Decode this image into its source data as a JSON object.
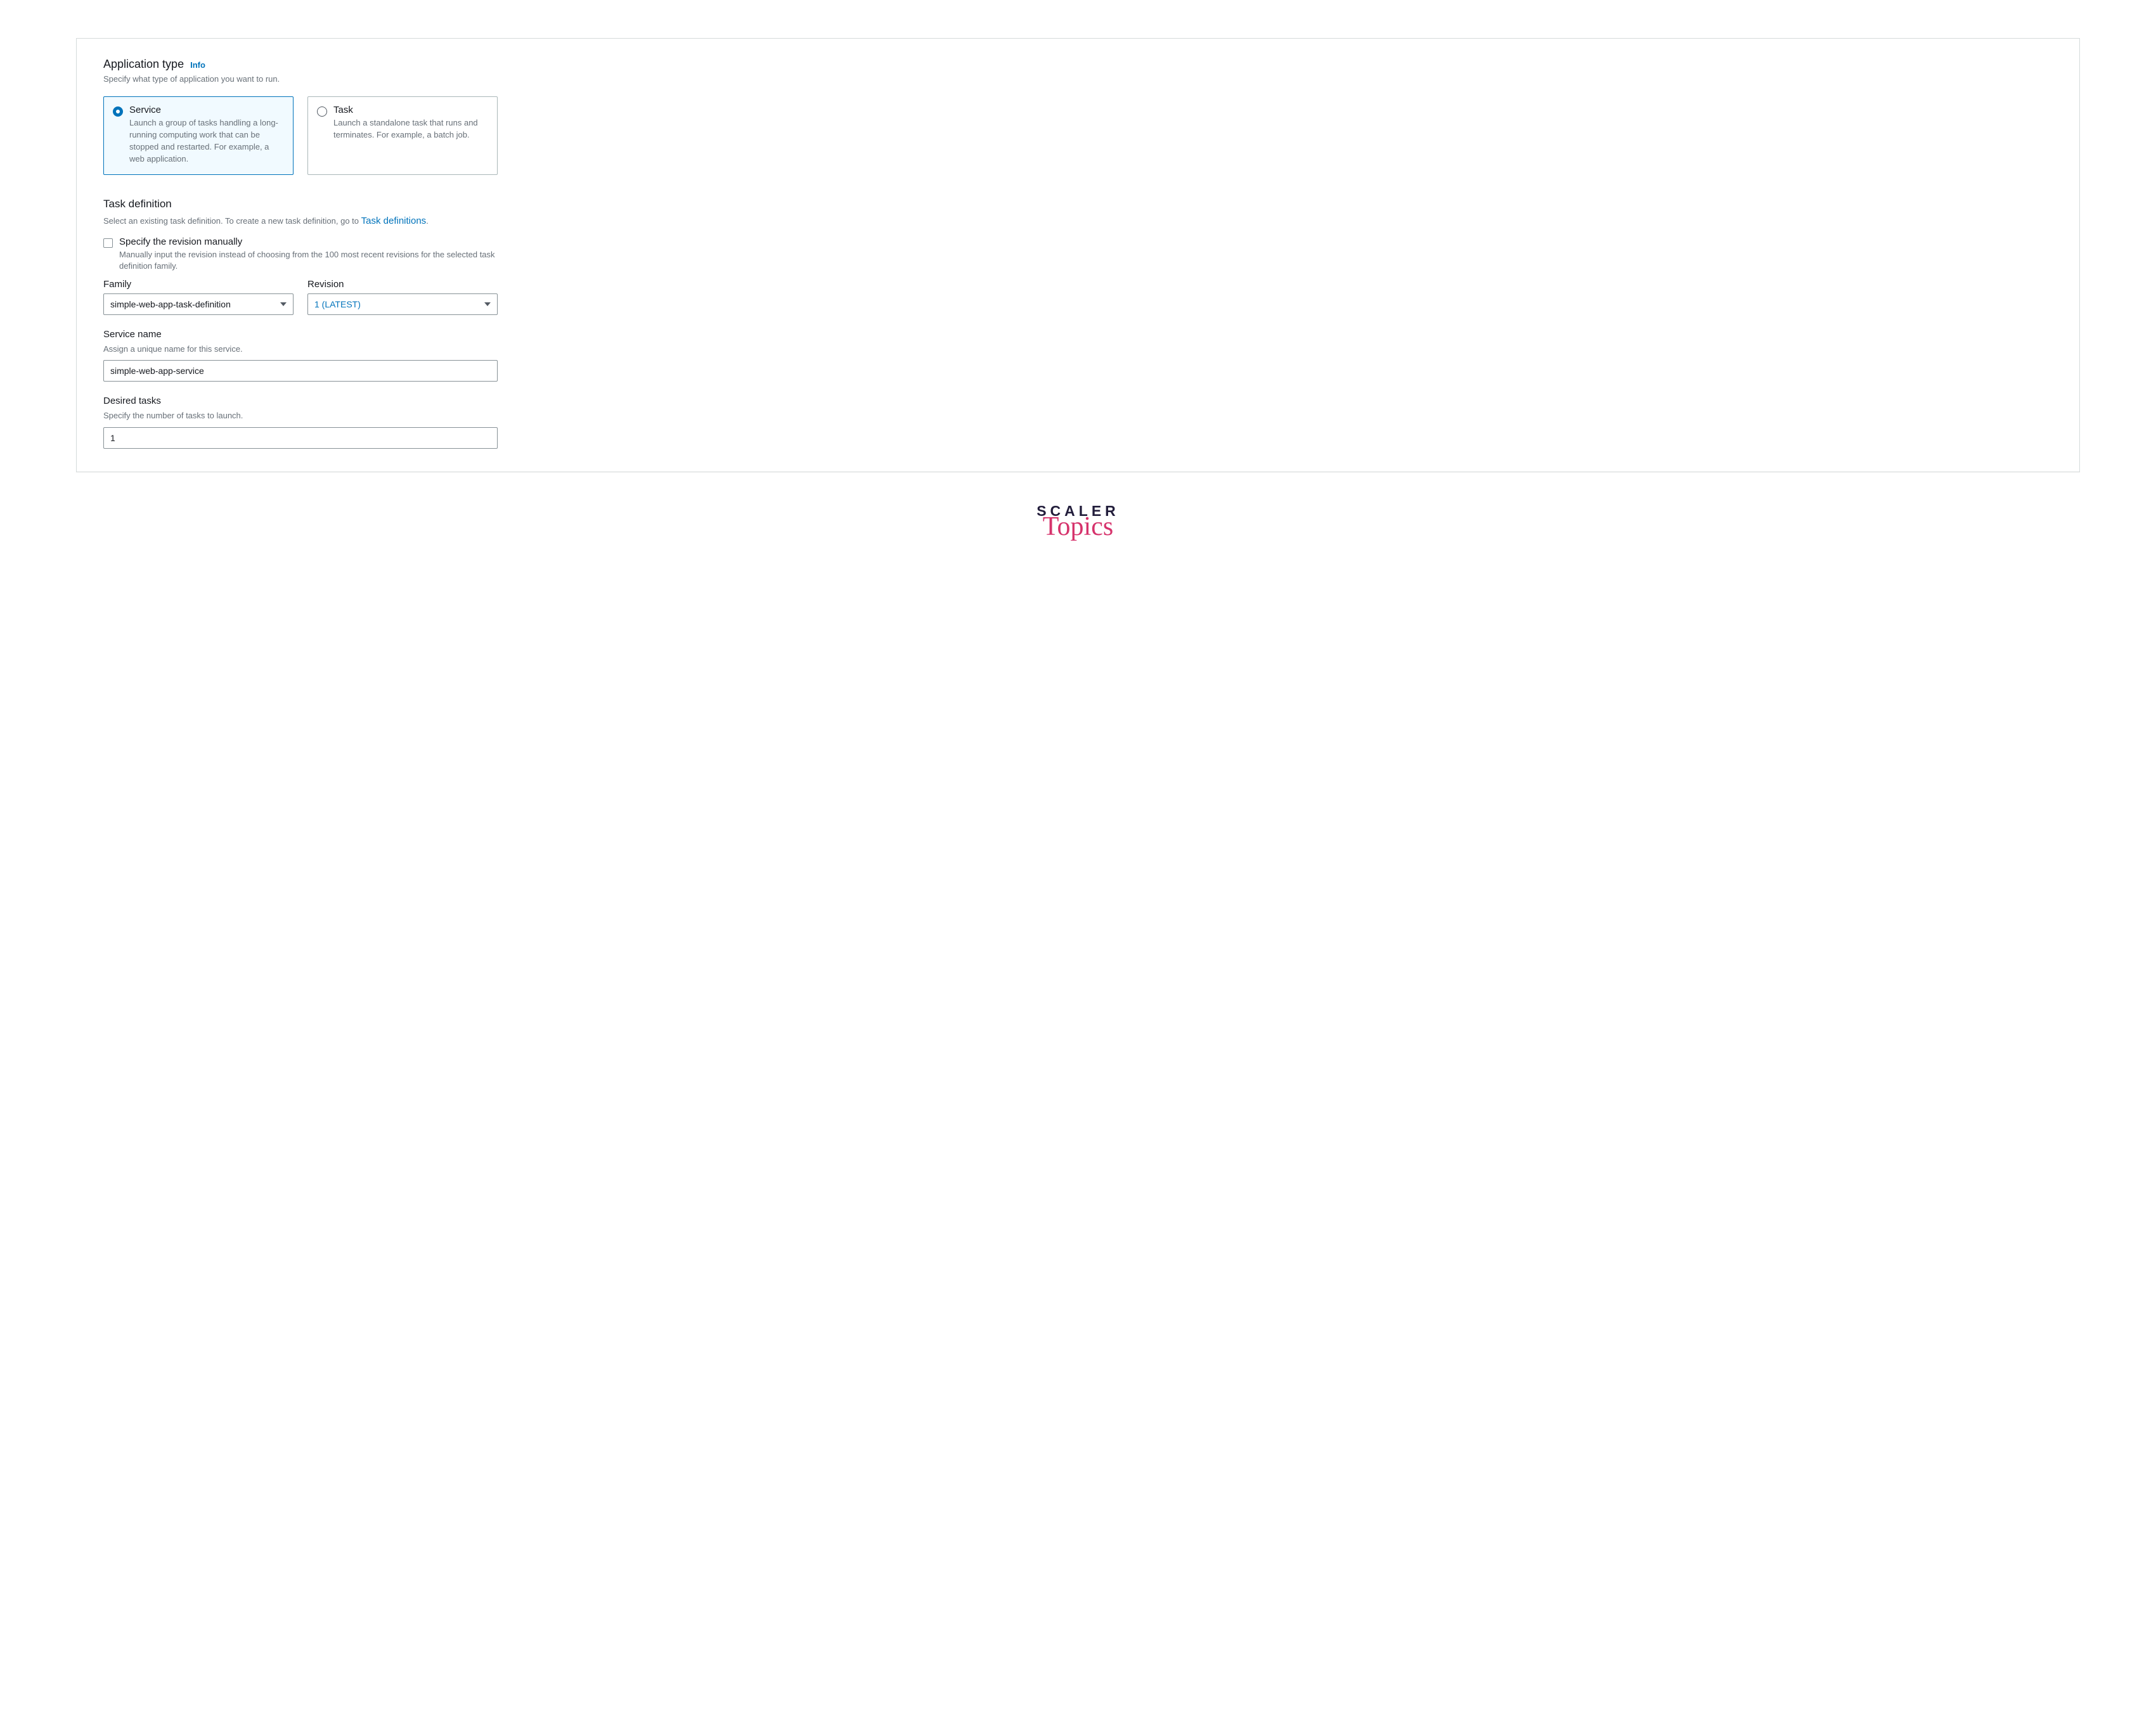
{
  "appType": {
    "title": "Application type",
    "infoLabel": "Info",
    "desc": "Specify what type of application you want to run.",
    "options": {
      "service": {
        "title": "Service",
        "desc": "Launch a group of tasks handling a long-running computing work that can be stopped and restarted. For example, a web application."
      },
      "task": {
        "title": "Task",
        "desc": "Launch a standalone task that runs and terminates. For example, a batch job."
      }
    }
  },
  "taskDef": {
    "title": "Task definition",
    "descPrefix": "Select an existing task definition. To create a new task definition, go to ",
    "linkText": "Task definitions",
    "descSuffix": ".",
    "checkbox": {
      "label": "Specify the revision manually",
      "desc": "Manually input the revision instead of choosing from the 100 most recent revisions for the selected task definition family."
    },
    "familyLabel": "Family",
    "familyValue": "simple-web-app-task-definition",
    "revisionLabel": "Revision",
    "revisionValue": "1 (LATEST)"
  },
  "serviceName": {
    "label": "Service name",
    "desc": "Assign a unique name for this service.",
    "value": "simple-web-app-service"
  },
  "desiredTasks": {
    "label": "Desired tasks",
    "desc": "Specify the number of tasks to launch.",
    "value": "1"
  },
  "brand": {
    "line1": "SCALER",
    "line2": "Topics"
  }
}
